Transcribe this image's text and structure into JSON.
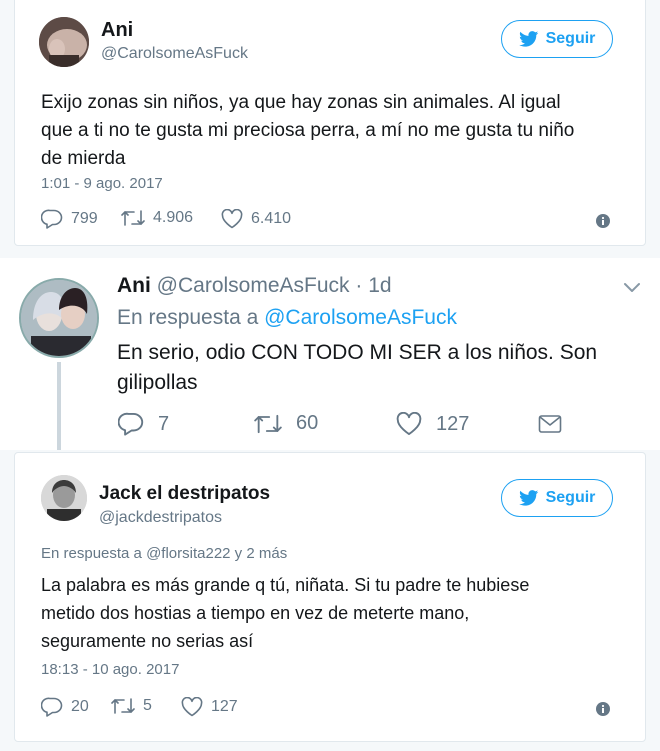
{
  "tweet1": {
    "name": "Ani",
    "handle": "@CarolsomeAsFuck",
    "follow_label": "Seguir",
    "text_lines": [
      "Exijo zonas sin niños, ya que hay zonas sin animales. Al igual",
      "que a ti no te gusta mi preciosa perra, a mí no me gusta tu niño",
      "de mierda"
    ],
    "timestamp": "1:01 - 9 ago. 2017",
    "replies": "799",
    "retweets": "4.906",
    "likes": "6.410"
  },
  "tweet2": {
    "name": "Ani",
    "handle_time": "@CarolsomeAsFuck · 1d",
    "reply_prefix": "En respuesta a",
    "reply_handle": "@CarolsomeAsFuck",
    "text_lines": [
      "En serio, odio CON TODO MI SER a los niños. Son",
      "gilipollas"
    ],
    "replies": "7",
    "retweets": "60",
    "likes": "127"
  },
  "tweet3": {
    "name": "Jack el destripatos",
    "handle": "@jackdestripatos",
    "follow_label": "Seguir",
    "reply_prefix": "En respuesta a",
    "reply_handle": "@florsita222 y 2 más",
    "text_lines": [
      "La palabra es más grande q tú, niñata. Si tu padre te hubiese",
      "metido dos hostias a tiempo en vez de meterte mano,",
      "seguramente no serias así"
    ],
    "timestamp": "18:13 - 10 ago. 2017",
    "replies": "20",
    "retweets": "5",
    "likes": "127"
  },
  "colors": {
    "twitter_blue": "#1da1f2",
    "secondary_text": "#657786",
    "border": "#e1e8ed"
  }
}
